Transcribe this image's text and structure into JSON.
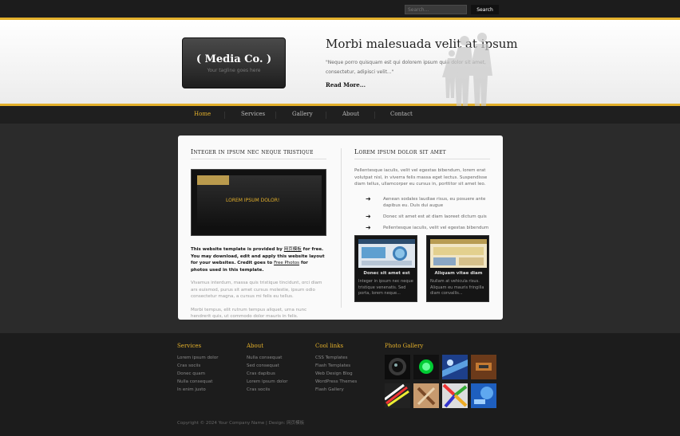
{
  "search": {
    "placeholder": "Search...",
    "button_label": "Search"
  },
  "header": {
    "logo_title": "( Media Co. )",
    "logo_tagline": "Your tagline goes here",
    "hero_title": "Morbi malesuada velit at ipsum",
    "hero_text": "\"Neque porro quisquam est qui dolorem ipsum quia dolor sit amet, consectetur, adipisci velit...\"",
    "read_more": "Read More..."
  },
  "nav": {
    "items": [
      {
        "label": "Home"
      },
      {
        "label": "Services"
      },
      {
        "label": "Gallery"
      },
      {
        "label": "About"
      },
      {
        "label": "Contact"
      }
    ]
  },
  "main": {
    "left_heading": "Integer in ipsum nec neque tristique",
    "screenshot_label": "LOREM IPSUM DOLOR!",
    "left_p1_start": "This website template is provided by ",
    "left_p1_link1": "网页模板",
    "left_p1_mid": " for free. You may download, edit and apply this website layout for your websites. Credit goes to ",
    "left_p1_link2": "Free Photos",
    "left_p1_end": " for photos used in this template.",
    "left_p2": "Vivamus interdum, massa quis tristique tincidunt, orci diam ars euismod, purus sit amet cursus molestie, ipsum odio consectetur magna, a cursus mi felis eu tellus.",
    "left_p3": "Morbi tempus, elit rutrum tempus aliquet, urna nunc hendrerit quis, ut commodo dolor mauris in felis.",
    "right_heading": "Lorem ipsum dolor sit amet",
    "right_p": "Pellentesque iaculis, velit vel egestas bibendum, lorem erat volutpat nisl, in viverra felis massa eget lectus. Suspendisse diam tellus, ullamcorper eu cursus in, porttitor sit amet leo.",
    "bullets": [
      "Aenean sodales laudiae risus, eu posuere ante dapibus eu. Duis dui augue",
      "Donec sit amet est at diam laoreet dictum quis",
      "Pellentesque iaculis, velit vel egestas bibendum"
    ],
    "cards": [
      {
        "title": "Donec sit amet est",
        "text": "Integer in ipsum nec neque tristique venenatis. Sed porta, lorem neque..."
      },
      {
        "title": "Aliquam vitae diam",
        "text": "Nullam at vehicula risus. Aliquam eu mauris fringilla diam convallis..."
      }
    ]
  },
  "footer": {
    "columns": [
      {
        "heading": "Services",
        "links": [
          "Lorem ipsum dolor",
          "Cras sociis",
          "Donec quam",
          "Nulla consequat",
          "In enim justo"
        ]
      },
      {
        "heading": "About",
        "links": [
          "Nulla consequat",
          "Sed consequat",
          "Cras dapibus",
          "Lorem ipsum dolor",
          "Cras sociis"
        ]
      },
      {
        "heading": "Cool links",
        "links": [
          "CSS Templates",
          "Flash Templates",
          "Web Design Blog",
          "WordPress Themes",
          "Flash Gallery"
        ]
      }
    ],
    "gallery_heading": "Photo Gallery",
    "copyright": "Copyright © 2024 Your Company Name | Design: 网页模板"
  },
  "colors": {
    "accent": "#e3b02b",
    "panel": "#fafafa",
    "bg": "#2b2b2b",
    "footer": "#1c1c1c"
  }
}
